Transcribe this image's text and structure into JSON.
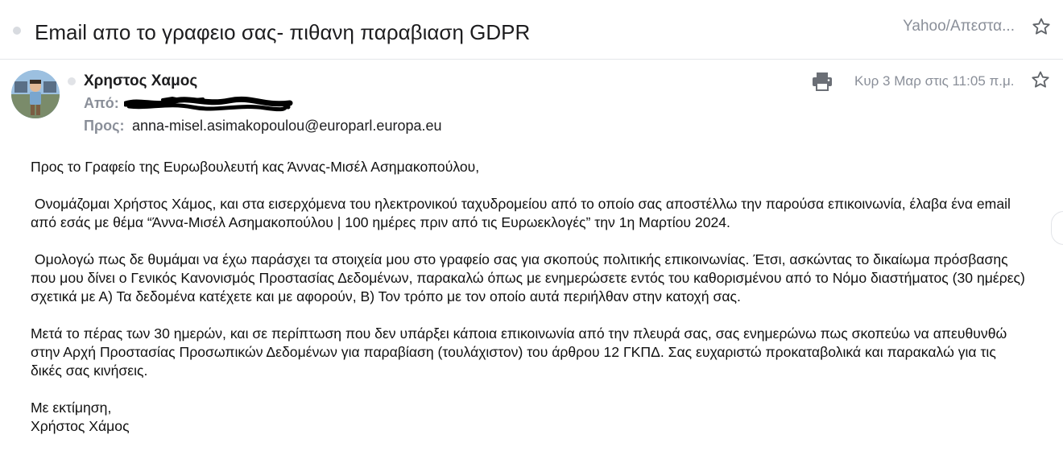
{
  "subject": {
    "title": "Email απο το γραφειο σας- πιθανη παραβιαση GDPR",
    "folder": "Yahoo/Απεστα..."
  },
  "message": {
    "sender_name": "Χρηστος Χαμος",
    "from_label": "Από:",
    "to_label": "Προς:",
    "to_address": "anna-misel.asimakopoulou@europarl.europa.eu",
    "timestamp": "Κυρ 3 Μαρ στις 11:05 π.μ."
  },
  "body": {
    "greeting": "Προς το Γραφείο της Ευρωβουλευτή κας Άννας-Μισέλ Ασημακοπούλου,",
    "paragraph1": " Ονομάζομαι Χρήστος Χάμος, και στα εισερχόμενα του ηλεκτρονικού ταχυδρομείου από το οποίο σας αποστέλλω την παρούσα επικοινωνία, έλαβα ένα email από εσάς με θέμα “Άννα-Μισέλ Ασημακοπούλου | 100 ημέρες πριν από τις Ευρωεκλογές” την 1η Μαρτίου 2024.",
    "paragraph2": " Ομολογώ πως δε θυμάμαι να έχω παράσχει τα στοιχεία μου στο γραφείο σας για σκοπούς πολιτικής επικοινωνίας. Έτσι, ασκώντας το δικαίωμα πρόσβασης που μου δίνει ο Γενικός Κανονισμός Προστασίας Δεδομένων, παρακαλώ όπως με ενημερώσετε εντός του καθορισμένου από το Νόμο διαστήματος (30 ημέρες) σχετικά με Α) Τα δεδομένα κατέχετε και με αφορούν, Β) Τον τρόπο με τον οποίο αυτά περιήλθαν στην κατοχή σας.",
    "paragraph3": "Μετά το πέρας των 30 ημερών, και σε περίπτωση που δεν υπάρξει κάποια επικοινωνία από την πλευρά σας, σας ενημερώνω πως σκοπεύω να απευθυνθώ στην Αρχή Προστασίας Προσωπικών Δεδομένων για παραβίαση (τουλάχιστον) του άρθρου 12 ΓΚΠΔ. Σας ευχαριστώ προκαταβολικά και παρακαλώ για τις δικές σας κινήσεις.",
    "closing": "Με εκτίμηση,",
    "signature": "Χρήστος Χάμος"
  },
  "icons": {
    "star": "star-outline-icon",
    "print": "printer-icon",
    "avatar": "user-avatar"
  },
  "colors": {
    "muted_text": "#8a8f99",
    "primary_text": "#1d1d1f",
    "redaction": "#000000"
  }
}
